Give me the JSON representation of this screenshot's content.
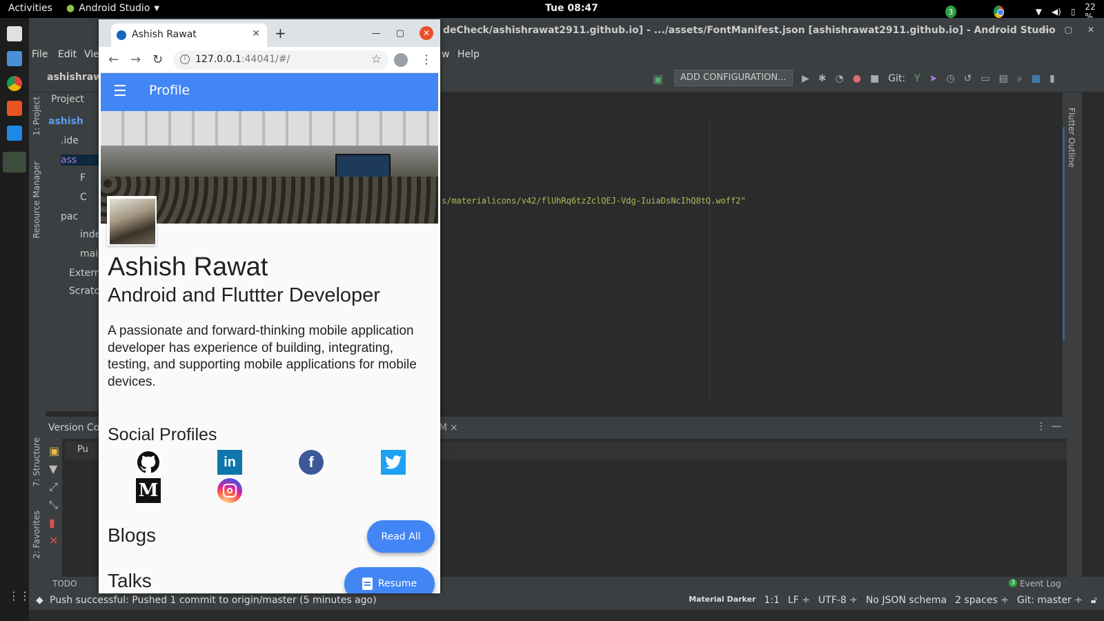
{
  "topbar": {
    "activities": "Activities",
    "app": "Android Studio",
    "clock": "Tue 08:47",
    "badge": "3",
    "battery": "22 %"
  },
  "ide": {
    "title": "deCheck/ashishrawat2911.github.io] - .../assets/FontManifest.json [ashishrawat2911.github.io] - Android Studio",
    "menu": [
      "File",
      "Edit",
      "Vie",
      "w",
      "Help"
    ],
    "add_config": "ADD CONFIGURATION...",
    "git_label": "Git:",
    "side_tabs": {
      "project": "1: Project",
      "resource": "Resource Manager",
      "structure": "7: Structure",
      "favorites": "2: Favorites",
      "flutter_outline": "Flutter Outline"
    },
    "project_tree": [
      {
        "label": "Project"
      },
      {
        "label": "ashish"
      },
      {
        "label": ".ide"
      },
      {
        "label": "ass"
      },
      {
        "label": "F"
      },
      {
        "label": "C"
      },
      {
        "label": "pac"
      },
      {
        "label": "inde"
      },
      {
        "label": "mai"
      },
      {
        "label": "Extern"
      },
      {
        "label": "Scratc"
      }
    ],
    "project_root": "ashishrawa",
    "code_line": "s/materialicons/v42/flUhRq6tzZclQEJ-Vdg-IuiaDsNcIhQ8tQ.woff2\"",
    "vcs_tab": "Version Co",
    "vcs_folder": "Pu",
    "vcs_tab_right": "M",
    "todo": "TODO",
    "event_log": "Event Log",
    "event_badge": "3",
    "status_message": "Push successful: Pushed 1 commit to origin/master (5 minutes ago)",
    "status_right": [
      "Material Darker",
      "1:1",
      "LF ÷",
      "UTF-8 ÷",
      "No JSON schema",
      "2 spaces ÷",
      "Git: master ÷"
    ]
  },
  "browser": {
    "tab_title": "Ashish Rawat",
    "url_host": "127.0.0.1",
    "url_rest": ":44041/#/"
  },
  "app": {
    "appbar_title": "Profile",
    "name": "Ashish Rawat",
    "role": "Android and Fluttter Developer",
    "bio": "A passionate and forward-thinking mobile application developer has experience of building, integrating, testing, and supporting mobile applications for mobile devices.",
    "social_heading": "Social Profiles",
    "social": [
      {
        "name": "github",
        "glyph": ""
      },
      {
        "name": "linkedin",
        "glyph": "in"
      },
      {
        "name": "facebook",
        "glyph": "f"
      },
      {
        "name": "twitter",
        "glyph": ""
      },
      {
        "name": "medium",
        "glyph": "M"
      },
      {
        "name": "instagram",
        "glyph": ""
      }
    ],
    "blogs_heading": "Blogs",
    "talks_heading": "Talks",
    "read_all": "Read All",
    "resume": "Resume"
  },
  "colors": {
    "accent": "#4285f4",
    "ide_bg": "#2b2b2b",
    "ide_panel": "#3c3f41"
  }
}
